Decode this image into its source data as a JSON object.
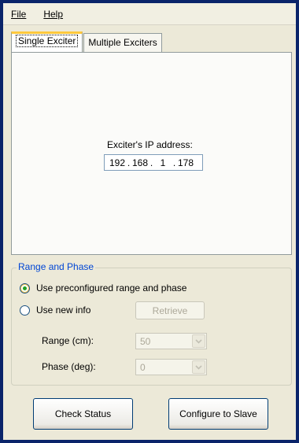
{
  "menu": {
    "file": "File",
    "help": "Help"
  },
  "tabs": [
    {
      "label": "Single Exciter"
    },
    {
      "label": "Multiple Exciters"
    }
  ],
  "single_exciter": {
    "ip_label": "Exciter's IP address:",
    "ip": [
      "192",
      "168",
      "1",
      "178"
    ]
  },
  "range_phase": {
    "title": "Range and Phase",
    "option_preconfigured": "Use preconfigured range and phase",
    "option_new": "Use new info",
    "selected": "preconfigured",
    "retrieve_label": "Retrieve",
    "range_label": "Range (cm):",
    "range_value": "50",
    "phase_label": "Phase (deg):",
    "phase_value": "0"
  },
  "actions": {
    "check_status": "Check Status",
    "configure_slave": "Configure to Slave"
  },
  "colors": {
    "window_border": "#0a246a",
    "group_title": "#0046d5",
    "radio_dot": "#21a121"
  }
}
